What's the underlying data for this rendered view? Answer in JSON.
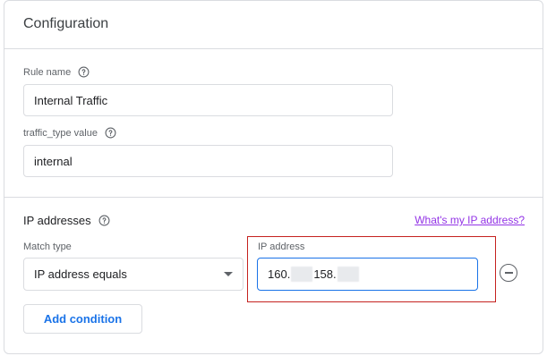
{
  "card": {
    "title": "Configuration"
  },
  "rule_name": {
    "label": "Rule name",
    "value": "Internal Traffic",
    "help_icon": "help-circle-icon"
  },
  "traffic_type": {
    "label": "traffic_type value",
    "value": "internal",
    "help_icon": "help-circle-icon"
  },
  "ip_section": {
    "title": "IP addresses",
    "help_icon": "help-circle-icon",
    "link": "What's my IP address?",
    "match_type_label": "Match type",
    "match_type_value": "IP address equals",
    "ip_label": "IP address",
    "ip_part1": "160.",
    "ip_part2": "158.",
    "remove_icon": "remove-circle-icon",
    "add_condition": "Add condition"
  },
  "colors": {
    "accent": "#1a73e8",
    "link": "#9334e6",
    "highlight": "#c5221f",
    "border": "#dadce0"
  }
}
